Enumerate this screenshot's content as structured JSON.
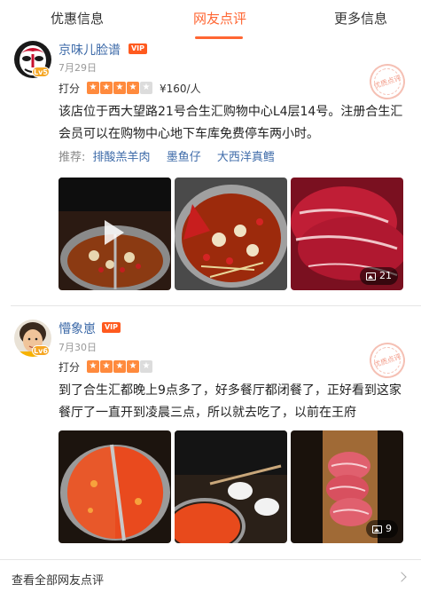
{
  "tabs": [
    "优惠信息",
    "网友点评",
    "更多信息"
  ],
  "active_tab": "网友点评",
  "accent_color": "#ff6633",
  "reviews": [
    {
      "user": "京味儿脸谱",
      "level": "Lv5",
      "vip": "VIP",
      "date": "7月29日",
      "score_label": "打分",
      "stars": 4,
      "price": "¥160/人",
      "text": "该店位于西大望路21号合生汇购物中心L4层14号。注册合生汇会员可以在购物中心地下车库免费停车两小时。",
      "recommend_label": "推荐:",
      "dishes": [
        "排酸羔羊肉",
        "墨鱼仔",
        "大西洋真鳕"
      ],
      "stamp": "优质点评",
      "photo_count": "21"
    },
    {
      "user": "懵象崽",
      "level": "Lv6",
      "vip": "VIP",
      "date": "7月30日",
      "score_label": "打分",
      "stars": 4,
      "text": "到了合生汇都晚上9点多了，好多餐厅都闭餐了，正好看到这家餐厅了一直开到凌晨三点，所以就去吃了，以前在王府",
      "stamp": "优质点评",
      "photo_count": "9"
    }
  ],
  "footer": {
    "label": "查看全部网友点评"
  }
}
